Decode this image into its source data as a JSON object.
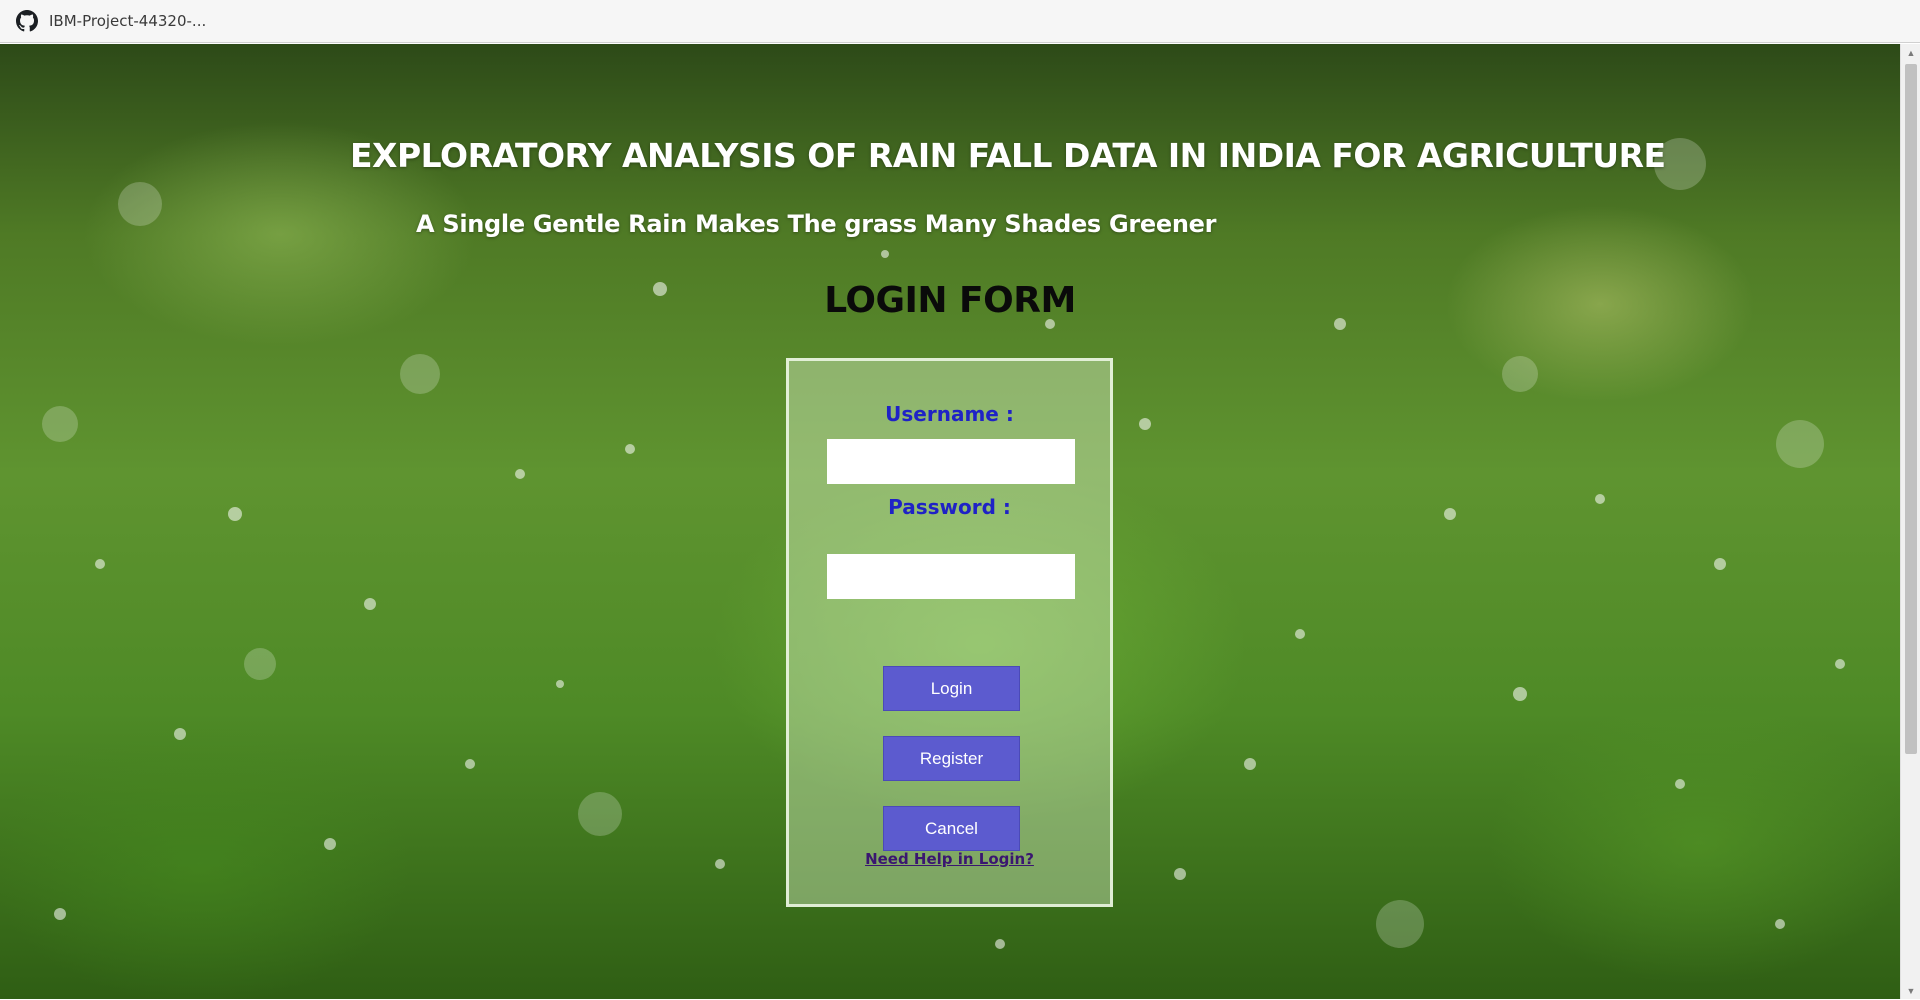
{
  "tab": {
    "title": "IBM-Project-44320-...",
    "icon": "github-icon"
  },
  "page": {
    "title": "EXPLORATORY ANALYSIS OF RAIN FALL DATA IN INDIA FOR AGRICULTURE",
    "subtitle": "A Single Gentle Rain Makes The grass Many Shades Greener",
    "form_title": "LOGIN FORM",
    "background": "grass-with-dew-image"
  },
  "login_form": {
    "username_label": "Username :",
    "username_value": "",
    "password_label": "Password :",
    "password_value": "",
    "login_label": "Login",
    "register_label": "Register",
    "cancel_label": "Cancel",
    "help_link": "Need Help in Login?"
  },
  "colors": {
    "label": "#1f22c6",
    "button": "#5c5bcf",
    "link": "#3a1670",
    "title": "#ffffff",
    "form_title": "#0a0a0a"
  }
}
